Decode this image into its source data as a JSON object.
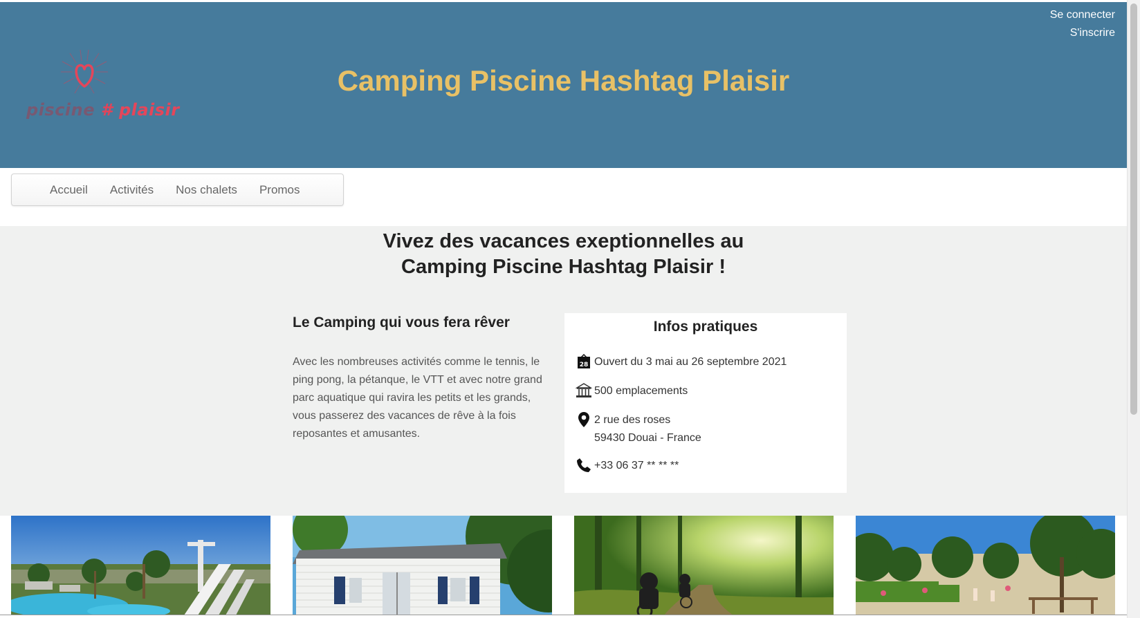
{
  "auth": {
    "login": "Se connecter",
    "register": "S'inscrire"
  },
  "logo": {
    "part1": "piscine",
    "hash": "#",
    "part2": "plaisir"
  },
  "site_title": "Camping Piscine Hashtag Plaisir",
  "nav": {
    "items": [
      "Accueil",
      "Activités",
      "Nos chalets",
      "Promos"
    ]
  },
  "headline": {
    "line1": "Vivez des vacances exeptionnelles au",
    "line2": "Camping Piscine Hashtag Plaisir !"
  },
  "intro": {
    "title": "Le Camping qui vous fera rêver",
    "text": "Avec les nombreuses activités comme le tennis, le ping pong, la pétanque, le VTT et avec notre grand parc aquatique qui ravira les petits et les grands, vous passerez des vacances de rêve à la fois reposantes et amusantes."
  },
  "infos": {
    "title": "Infos pratiques",
    "calendar_day": "28",
    "opening": "Ouvert du 3 mai au 26 septembre 2021",
    "spots": "500 emplacements",
    "address_line1": "2 rue des roses",
    "address_line2": "59430 Douai - France",
    "phone": "+33 06 37 ** ** **"
  },
  "icons": [
    "heart-logo-icon",
    "calendar-icon",
    "building-icon",
    "map-pin-icon",
    "phone-icon"
  ],
  "colors": {
    "header_bg": "#467b9c",
    "title": "#e8c166",
    "main_bg": "#f0f1f0",
    "logo_accent": "#e5465a"
  },
  "photos": [
    "Parc aquatique avec toboggans",
    "Mobil-home blanc",
    "VTT en forêt",
    "Espace verdoyant du camping"
  ]
}
